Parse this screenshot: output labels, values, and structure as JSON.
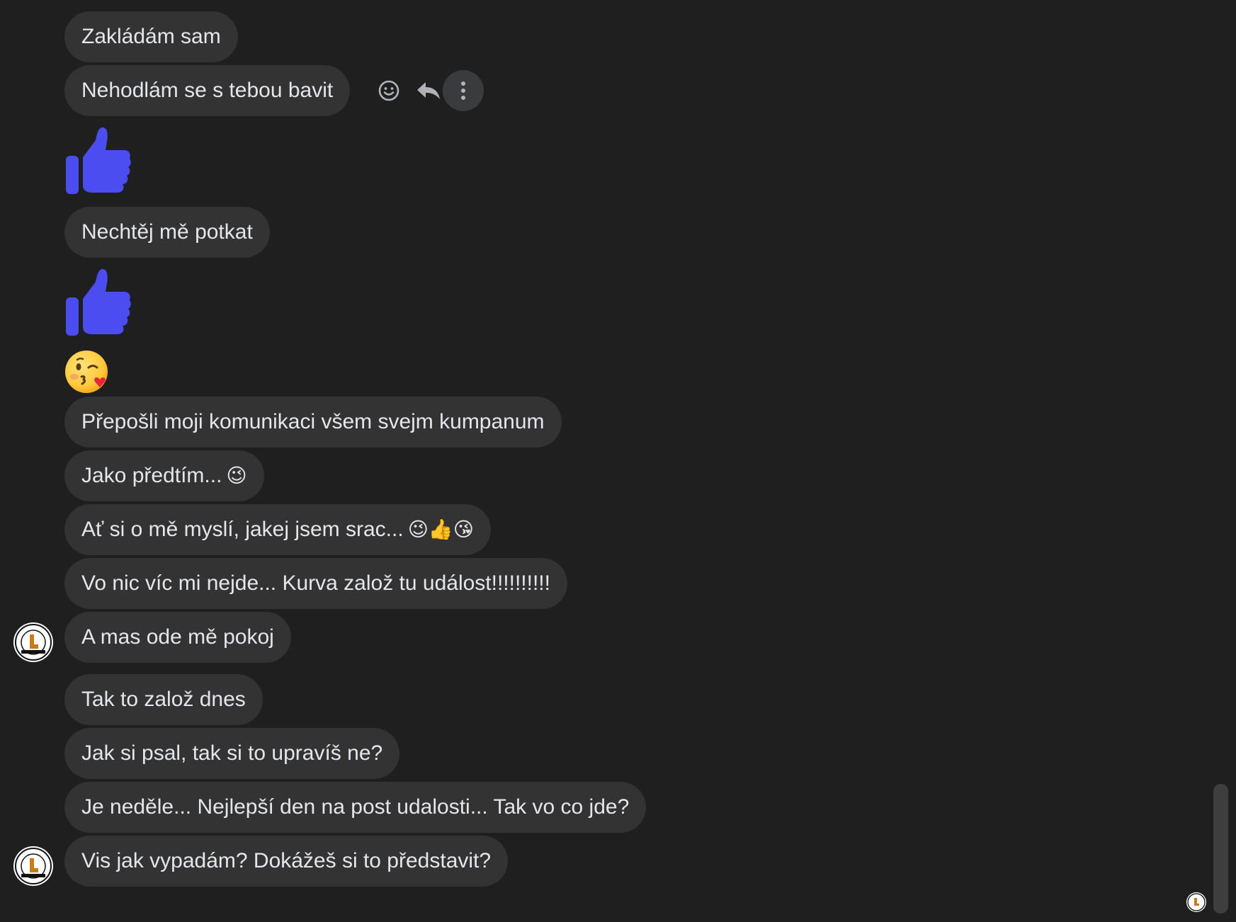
{
  "messages": [
    {
      "text": "Zakládám sam"
    },
    {
      "text": "Nehodlám se s tebou bavit"
    },
    {
      "text": "Nechtěj mě potkat"
    },
    {
      "text": "Přepošli moji komunikaci všem svejm kumpanum"
    },
    {
      "text": "Jako předtím...",
      "emoji": "😉"
    },
    {
      "text": "Ať si o mě myslí, jakej jsem srac...",
      "emoji": "😉👍😘"
    },
    {
      "text": "Vo nic víc mi nejde... Kurva založ tu událost!!!!!!!!!!"
    },
    {
      "text": "A mas ode mě pokoj"
    },
    {
      "text": "Tak to založ dnes"
    },
    {
      "text": "Jak si psal, tak si to upravíš ne?"
    },
    {
      "text": "Je neděle... Nejlepší den na post udalosti... Tak vo co jde?"
    },
    {
      "text": "Vis jak vypadám? Dokážeš si to představit?"
    }
  ],
  "sticker": {
    "name": "thumbs-up-sticker",
    "color": "#4b4df0"
  },
  "big_emoji": {
    "name": "kissing-face-emoji"
  },
  "message_actions": [
    "react-icon",
    "reply-icon",
    "more-options-icon"
  ],
  "colors": {
    "background": "#1f1f1f",
    "bubble": "#333333",
    "text": "#e4e6eb",
    "icon": "#b0b3b8",
    "accent": "#4b4df0"
  }
}
